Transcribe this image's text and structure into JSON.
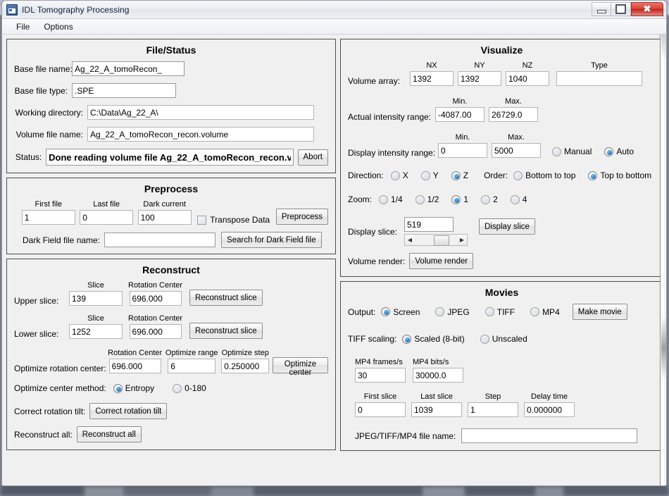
{
  "window": {
    "title": "IDL Tomography Processing",
    "icon": "app-window-icon",
    "minimize_label": "—",
    "maximize_label": "□",
    "close_label": "✕"
  },
  "menubar": {
    "items": [
      {
        "label": "File"
      },
      {
        "label": "Options"
      }
    ]
  },
  "file_status": {
    "title": "File/Status",
    "base_file_name_label": "Base file name:",
    "base_file_name_value": "Ag_22_A_tomoRecon_",
    "base_file_type_label": "Base file type:",
    "base_file_type_value": ".SPE",
    "working_directory_label": "Working directory:",
    "working_directory_value": "C:\\Data\\Ag_22_A\\",
    "volume_file_name_label": "Volume file name:",
    "volume_file_name_value": "Ag_22_A_tomoRecon_recon.volume",
    "status_label": "Status:",
    "status_value": "Done reading volume file Ag_22_A_tomoRecon_recon.v",
    "abort_label": "Abort"
  },
  "preprocess": {
    "title": "Preprocess",
    "first_file_header": "First file",
    "first_file_value": "1",
    "last_file_header": "Last file",
    "last_file_value": "0",
    "dark_current_header": "Dark current",
    "dark_current_value": "100",
    "transpose_label": "Transpose Data",
    "transpose_checked": false,
    "preprocess_button": "Preprocess",
    "dark_field_label": "Dark Field file name:",
    "dark_field_value": "",
    "search_dark_field_button": "Search for Dark Field file"
  },
  "reconstruct": {
    "title": "Reconstruct",
    "slice_header": "Slice",
    "rotation_center_header": "Rotation Center",
    "upper_slice_label": "Upper slice:",
    "upper_slice_value": "139",
    "upper_rotation_center_value": "696.000",
    "upper_reconstruct_button": "Reconstruct slice",
    "lower_slice_label": "Lower slice:",
    "lower_slice_value": "1252",
    "lower_rotation_center_value": "696.000",
    "lower_reconstruct_button": "Reconstruct slice",
    "optimize_rotation_center_label": "Optimize rotation center:",
    "optimize_rotation_center_header": "Rotation Center",
    "optimize_range_header": "Optimize range",
    "optimize_step_header": "Optimize step",
    "optimize_rotation_center_value": "696.000",
    "optimize_range_value": "6",
    "optimize_step_value": "0.250000",
    "optimize_center_button": "Optimize center",
    "optimize_method_label": "Optimize center method:",
    "method_entropy": "Entropy",
    "method_0_180": "0-180",
    "method_selected": "Entropy",
    "correct_tilt_label": "Correct rotation tilt:",
    "correct_tilt_button": "Correct rotation tilt",
    "reconstruct_all_label": "Reconstruct all:",
    "reconstruct_all_button": "Reconstruct all"
  },
  "visualize": {
    "title": "Visualize",
    "volume_array_label": "Volume array:",
    "nx_header": "NX",
    "ny_header": "NY",
    "nz_header": "NZ",
    "type_header": "Type",
    "nx_value": "1392",
    "ny_value": "1392",
    "nz_value": "1040",
    "type_value": "",
    "actual_intensity_label": "Actual intensity range:",
    "min_header": "Min.",
    "max_header": "Max.",
    "actual_min_value": "-4087.00",
    "actual_max_value": "26729.0",
    "display_intensity_label": "Display intensity range:",
    "display_min_header": "Min.",
    "display_max_header": "Max.",
    "display_min_value": "0",
    "display_max_value": "5000",
    "manual_label": "Manual",
    "auto_label": "Auto",
    "intensity_mode_selected": "Auto",
    "direction_label": "Direction:",
    "direction_options": [
      "X",
      "Y",
      "Z"
    ],
    "direction_selected": "Z",
    "order_label": "Order:",
    "order_options": [
      "Bottom to top",
      "Top to bottom"
    ],
    "order_selected": "Top to bottom",
    "zoom_label": "Zoom:",
    "zoom_options": [
      "1/4",
      "1/2",
      "1",
      "2",
      "4"
    ],
    "zoom_selected": "1",
    "display_slice_label": "Display slice:",
    "display_slice_value": "519",
    "display_slice_button": "Display slice",
    "volume_render_label": "Volume render:",
    "volume_render_button": "Volume render"
  },
  "movies": {
    "title": "Movies",
    "output_label": "Output:",
    "output_options": [
      "Screen",
      "JPEG",
      "TIFF",
      "MP4"
    ],
    "output_selected": "Screen",
    "make_movie_button": "Make movie",
    "tiff_scaling_label": "TIFF scaling:",
    "tiff_scaling_options": [
      "Scaled (8-bit)",
      "Unscaled"
    ],
    "tiff_scaling_selected": "Scaled (8-bit)",
    "mp4_frames_header": "MP4 frames/s",
    "mp4_frames_value": "30",
    "mp4_bits_header": "MP4 bits/s",
    "mp4_bits_value": "30000.0",
    "first_slice_header": "First slice",
    "first_slice_value": "0",
    "last_slice_header": "Last slice",
    "last_slice_value": "1039",
    "step_header": "Step",
    "step_value": "1",
    "delay_time_header": "Delay time",
    "delay_time_value": "0.000000",
    "file_name_label": "JPEG/TIFF/MP4 file name:",
    "file_name_value": ""
  },
  "colors": {
    "accent_blue": "#1d6fb8",
    "close_red": "#c3241c",
    "panel_border": "#4d4d4d",
    "window_bg": "#f0f0f0"
  }
}
